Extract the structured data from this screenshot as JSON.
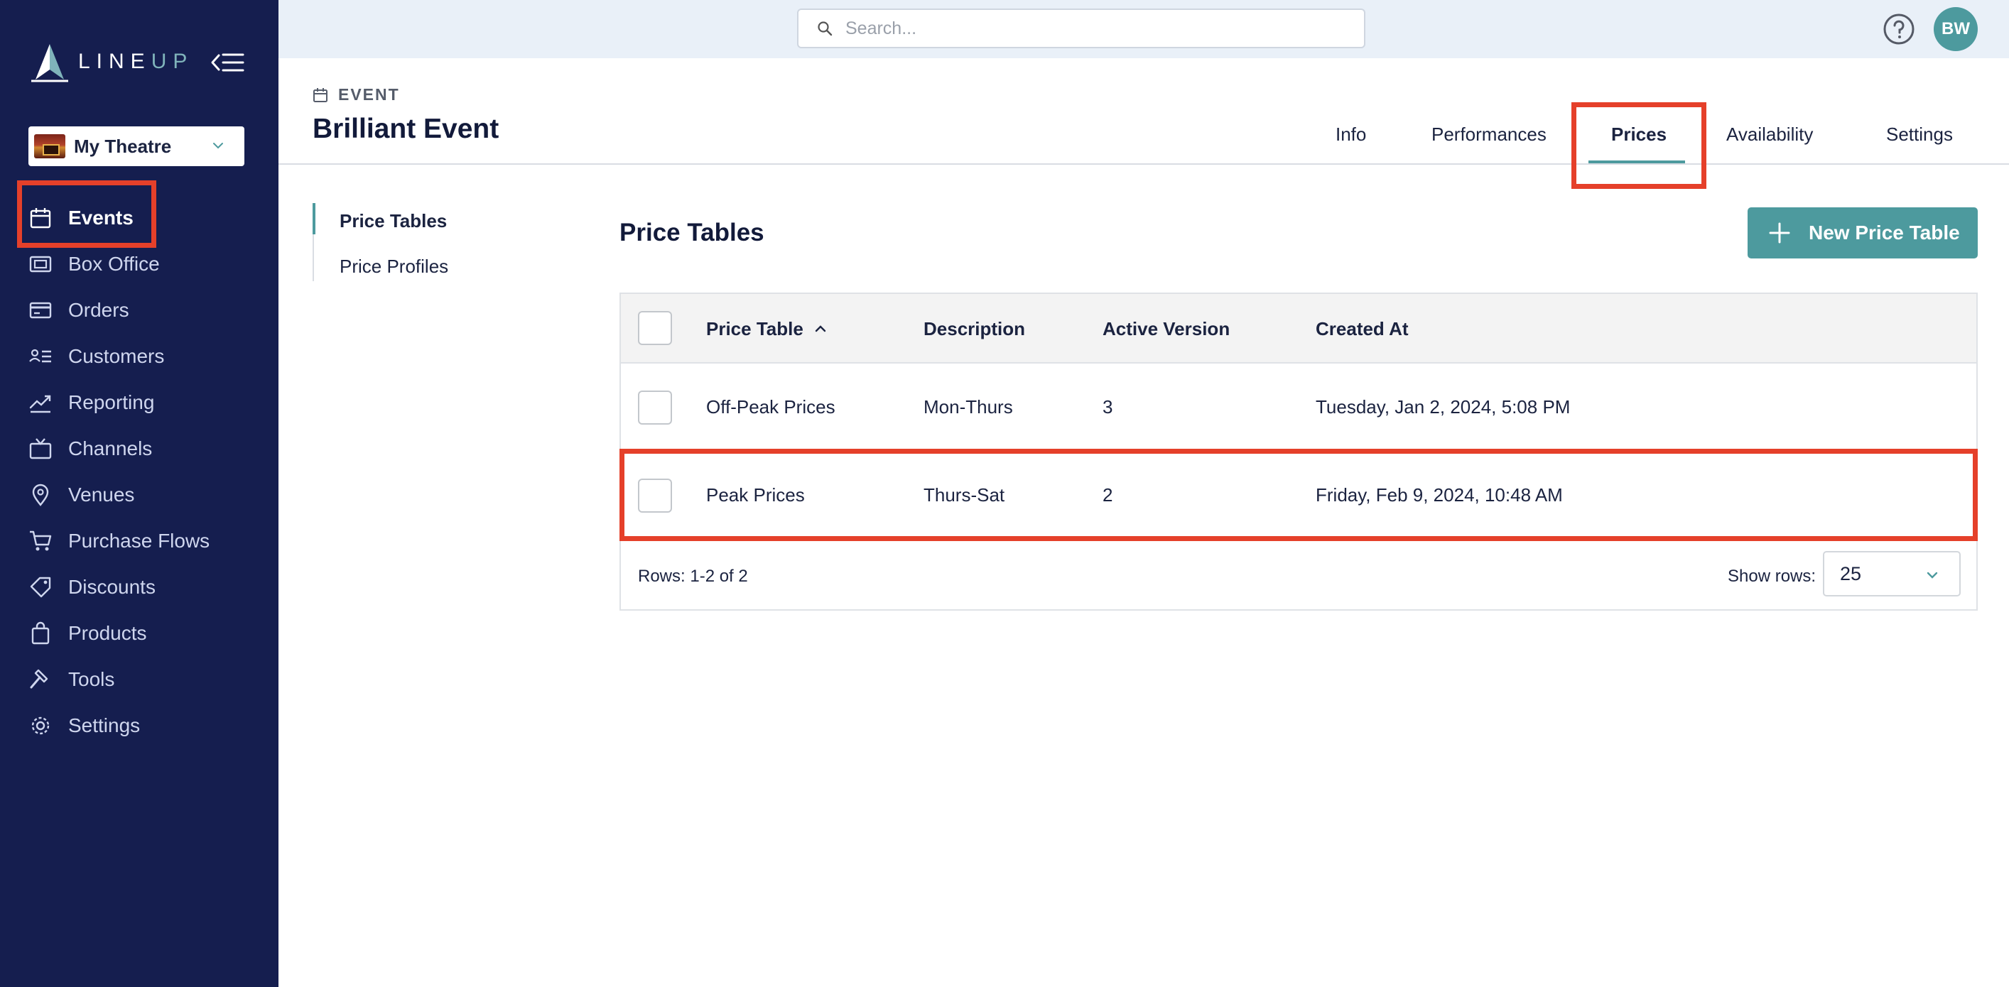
{
  "app": {
    "logo_text_main": "LINE",
    "logo_text_accent": "UP",
    "venue": "My Theatre"
  },
  "sidebar": {
    "items": [
      {
        "label": "Events",
        "icon": "calendar-icon",
        "active": true
      },
      {
        "label": "Box Office",
        "icon": "ticket-icon",
        "active": false
      },
      {
        "label": "Orders",
        "icon": "credit-card-icon",
        "active": false
      },
      {
        "label": "Customers",
        "icon": "contacts-icon",
        "active": false
      },
      {
        "label": "Reporting",
        "icon": "trend-chart-icon",
        "active": false
      },
      {
        "label": "Channels",
        "icon": "tv-icon",
        "active": false
      },
      {
        "label": "Venues",
        "icon": "location-pin-icon",
        "active": false
      },
      {
        "label": "Purchase Flows",
        "icon": "cart-icon",
        "active": false
      },
      {
        "label": "Discounts",
        "icon": "tag-icon",
        "active": false
      },
      {
        "label": "Products",
        "icon": "shopping-bag-icon",
        "active": false
      },
      {
        "label": "Tools",
        "icon": "hammer-icon",
        "active": false
      },
      {
        "label": "Settings",
        "icon": "gear-icon",
        "active": false
      }
    ]
  },
  "topbar": {
    "search_placeholder": "Search...",
    "avatar_initials": "BW"
  },
  "header": {
    "kicker": "EVENT",
    "title": "Brilliant Event",
    "tabs": [
      {
        "label": "Info",
        "active": false
      },
      {
        "label": "Performances",
        "active": false
      },
      {
        "label": "Prices",
        "active": true
      },
      {
        "label": "Availability",
        "active": false
      },
      {
        "label": "Settings",
        "active": false
      }
    ]
  },
  "subnav": {
    "items": [
      {
        "label": "Price Tables",
        "active": true
      },
      {
        "label": "Price Profiles",
        "active": false
      }
    ]
  },
  "main": {
    "section_title": "Price Tables",
    "new_button_label": "New Price Table",
    "table": {
      "columns": [
        "Price Table",
        "Description",
        "Active Version",
        "Created At"
      ],
      "sort": {
        "column": "Price Table",
        "direction": "ascending"
      },
      "rows": [
        {
          "price_table": "Off-Peak Prices",
          "description": "Mon-Thurs",
          "active_version": "3",
          "created_at": "Tuesday, Jan 2, 2024, 5:08 PM"
        },
        {
          "price_table": "Peak Prices",
          "description": "Thurs-Sat",
          "active_version": "2",
          "created_at": "Friday, Feb 9, 2024, 10:48 AM"
        }
      ],
      "rows_info": "Rows: 1-2 of 2",
      "show_rows_label": "Show rows:",
      "show_rows_value": "25"
    }
  },
  "colors": {
    "sidebar_bg": "#151e4f",
    "accent_teal": "#4d9a9e",
    "highlight_red": "#e5402a",
    "topbar_bg": "#e9f0f8"
  }
}
